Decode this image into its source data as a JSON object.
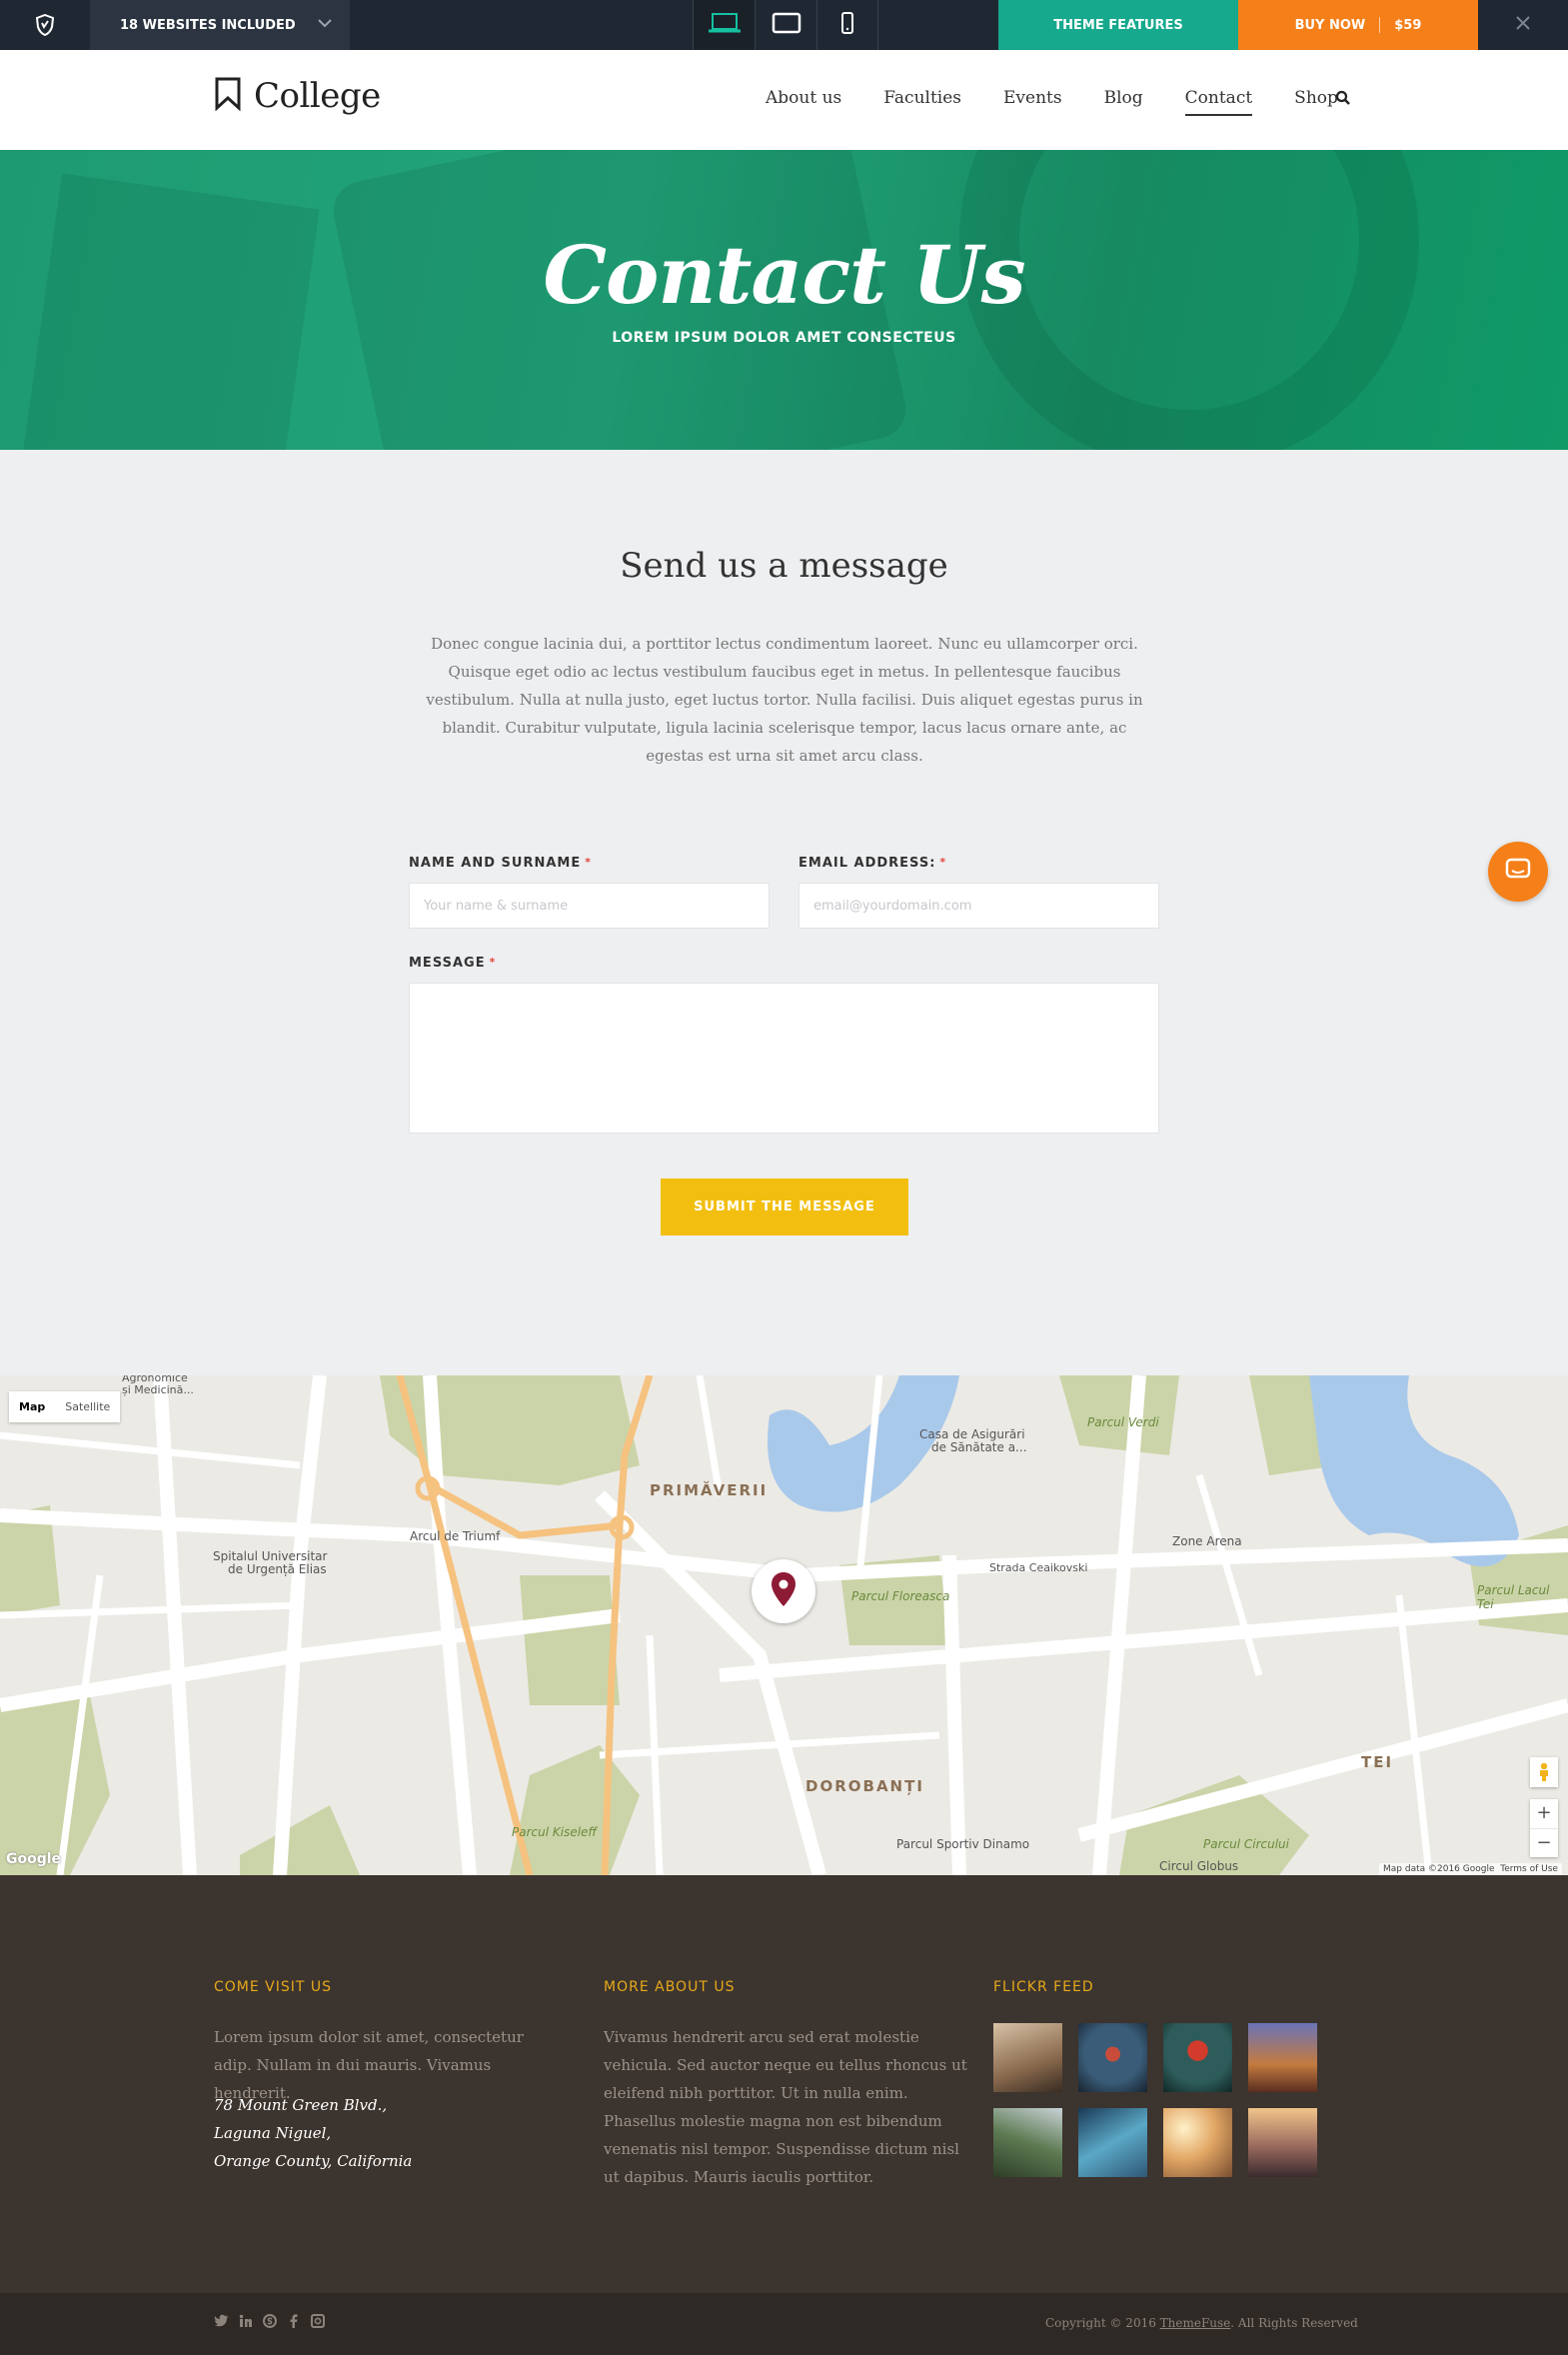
{
  "topbar": {
    "sites_label": "18 WEBSITES INCLUDED",
    "features_label": "THEME FEATURES",
    "buy_label": "BUY NOW",
    "price": "$59",
    "accent_teal": "#16a98d",
    "accent_orange": "#f57f18"
  },
  "header": {
    "logo_text": "College",
    "nav": [
      "About us",
      "Faculties",
      "Events",
      "Blog",
      "Contact",
      "Shop"
    ],
    "active_nav": "Contact"
  },
  "hero": {
    "title": "Contact Us",
    "subtitle": "LOREM IPSUM DOLOR AMET CONSECTEUS",
    "color": "#1e9a72"
  },
  "message": {
    "title": "Send us a message",
    "text": "Donec congue lacinia dui, a porttitor lectus condimentum laoreet. Nunc eu ullamcorper orci. Quisque eget odio ac lectus vestibulum faucibus eget in metus. In pellentesque faucibus vestibulum. Nulla at nulla justo, eget luctus tortor. Nulla facilisi. Duis aliquet egestas purus in blandit. Curabitur vulputate, ligula lacinia scelerisque tempor, lacus lacus ornare ante, ac egestas est urna sit amet arcu class."
  },
  "form": {
    "name_label": "NAME AND SURNAME",
    "name_placeholder": "Your name & surname",
    "email_label": "EMAIL ADDRESS:",
    "email_placeholder": "email@yourdomain.com",
    "message_label": "MESSAGE",
    "required_mark": "*",
    "submit_label": "SUBMIT THE MESSAGE",
    "submit_color": "#f2bf11"
  },
  "map": {
    "type_map": "Map",
    "type_satellite": "Satellite",
    "areas": [
      "PRIMĂVERII",
      "DOROBANȚI",
      "TEI"
    ],
    "labels": {
      "arcul": "Arcul de Triumf",
      "spital1": "Spitalul Universitar",
      "spital2": "de Urgență Elias",
      "casa1": "Casa de Asigurări",
      "casa2": "de Sănătate a...",
      "zone": "Zone Arena",
      "sportiv": "Parcul Sportiv Dinamo",
      "circul": "Circul Globus",
      "agro1": "Agronomice",
      "agro2": "și Medicină...",
      "ceaikovski": "Strada Ceaikovski",
      "kiseleff": "Parcul Kiseleff",
      "verdi": "Parcul Verdi",
      "floreasca": "Parcul Floreasca",
      "circului": "Parcul Circului",
      "lacul_tei": "Parcul Lacul Tei"
    },
    "attribution": "Map data ©2016 Google",
    "terms": "Terms of Use",
    "google": "Google",
    "zoom_in": "+",
    "zoom_out": "−"
  },
  "footer": {
    "visit_title": "COME VISIT US",
    "visit_text": "Lorem ipsum dolor sit amet, consectetur adip. Nullam in dui mauris. Vivamus hendrerit.",
    "address": [
      "78 Mount Green Blvd.,",
      "Laguna Niguel,",
      "Orange County, California"
    ],
    "about_title": "MORE ABOUT US",
    "about_text": "Vivamus hendrerit arcu sed erat molestie vehicula. Sed auctor neque eu tellus rhoncus ut eleifend nibh porttitor. Ut in nulla enim. Phasellus molestie magna non est bibendum venenatis nisl tempor. Suspendisse dictum nisl ut dapibus. Mauris iaculis porttitor.",
    "flickr_title": "FLICKR FEED",
    "flickr_colors": [
      "#8a6a4e",
      "#3a5c78",
      "#2d5c5a",
      "#c47a3e",
      "#5d7a52",
      "#2f5876",
      "#e2a765",
      "#9a6a5e"
    ],
    "copyright_prefix": "Copyright © 2016 ",
    "copyright_brand": "ThemeFuse",
    "copyright_suffix": ". All Rights Reserved",
    "accent": "#e6a91a"
  }
}
